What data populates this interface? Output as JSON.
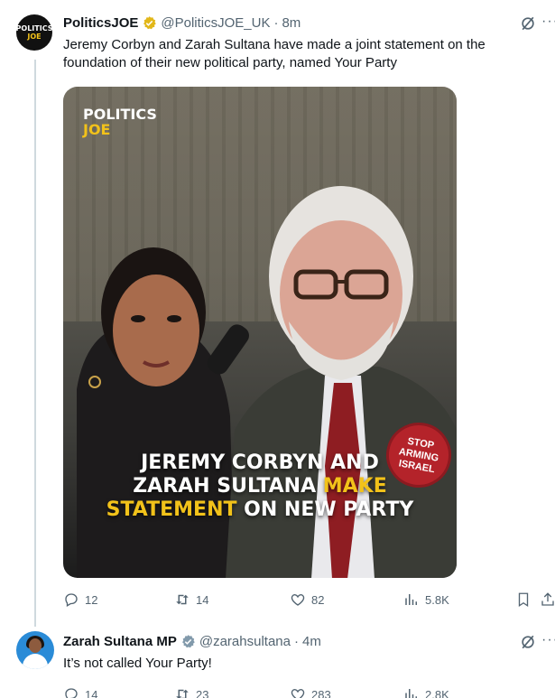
{
  "colors": {
    "accent_yellow": "#f2c21a",
    "gray_text": "#536471",
    "verified_gold": "#e2b719",
    "verified_gray": "#829aab"
  },
  "tweet1": {
    "avatar_text": [
      "POLITICS",
      "JOE"
    ],
    "name": "PoliticsJOE",
    "handle": "@PoliticsJOE_UK",
    "dot": "·",
    "time": "8m",
    "text_line1": "Jeremy Corbyn and Zarah Sultana have made a joint statement on the",
    "text_line2": "foundation of their new political party, named Your Party",
    "media": {
      "logo_line1": "POLITICS",
      "logo_line2": "JOE",
      "badge_lines": [
        "STOP",
        "ARMING",
        "ISRAEL"
      ],
      "headline_line1": "JEREMY CORBYN AND",
      "headline_line2a": "ZARAH SULTANA ",
      "headline_line2b": "MAKE",
      "headline_line3a": "STATEMENT",
      "headline_line3b": " ON NEW PARTY"
    },
    "stats": {
      "replies": "12",
      "reposts": "14",
      "likes": "82",
      "views": "5.8K"
    }
  },
  "tweet2": {
    "name": "Zarah Sultana MP",
    "handle": "@zarahsultana",
    "dot": "·",
    "time": "4m",
    "text": "It’s not called Your Party!",
    "stats": {
      "replies": "14",
      "reposts": "23",
      "likes": "283",
      "views": "2.8K"
    }
  },
  "icons": [
    "grok-icon",
    "more-icon",
    "reply-icon",
    "repost-icon",
    "like-icon",
    "views-icon",
    "bookmark-icon",
    "share-icon",
    "verified-icon"
  ]
}
